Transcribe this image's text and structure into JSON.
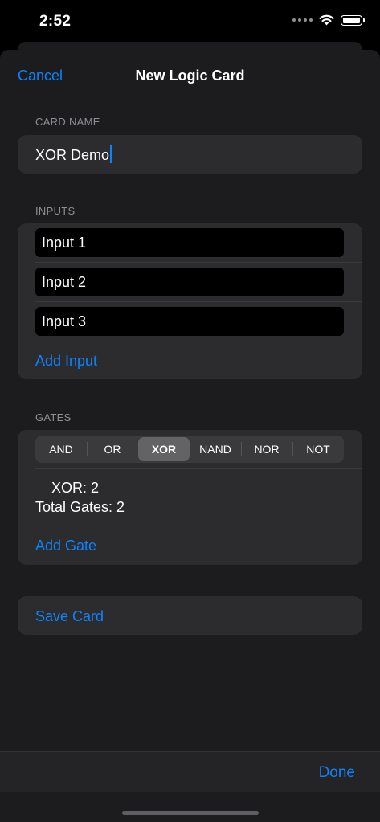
{
  "status_bar": {
    "time": "2:52"
  },
  "nav": {
    "cancel_label": "Cancel",
    "title": "New Logic Card"
  },
  "card_name": {
    "header": "CARD NAME",
    "value": "XOR Demo"
  },
  "inputs": {
    "header": "INPUTS",
    "items": [
      "Input 1",
      "Input 2",
      "Input 3"
    ],
    "add_label": "Add Input"
  },
  "gates": {
    "header": "GATES",
    "segments": [
      "AND",
      "OR",
      "XOR",
      "NAND",
      "NOR",
      "NOT"
    ],
    "selected": "XOR",
    "selected_count": "XOR: 2",
    "total": "Total Gates: 2",
    "add_label": "Add Gate"
  },
  "save": {
    "label": "Save Card"
  },
  "toolbar": {
    "done_label": "Done"
  },
  "colors": {
    "accent": "#0a84ff",
    "background": "#000000",
    "sheet": "#1c1c1e",
    "group": "#2c2c2e",
    "secondary_text": "#8e8e93"
  }
}
